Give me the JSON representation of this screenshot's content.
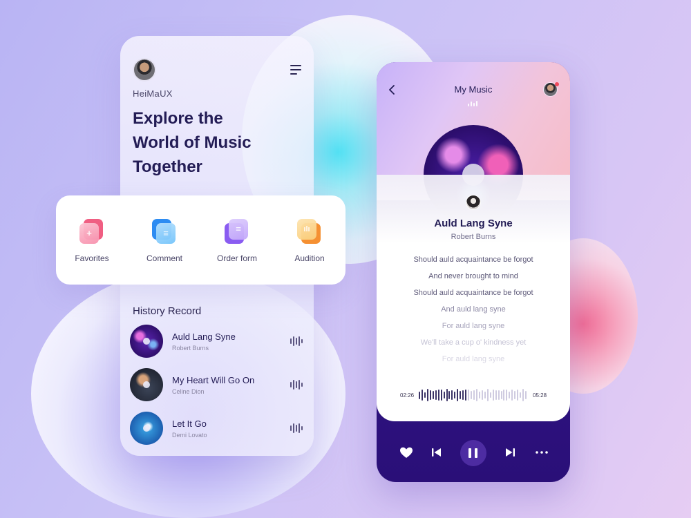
{
  "left_screen": {
    "user_name": "HeiMaUX",
    "hero_title_lines": [
      "Explore the",
      "World of Music",
      "Together"
    ],
    "history_title": "History Record",
    "history": [
      {
        "title": "Auld Lang Syne",
        "artist": "Robert Burns"
      },
      {
        "title": "My Heart Will Go On",
        "artist": "Celine Dion"
      },
      {
        "title": "Let It Go",
        "artist": "Demi Lovato"
      }
    ]
  },
  "categories": [
    {
      "label": "Favorites",
      "icon": "plus-icon",
      "colors": [
        "#f9a7bf",
        "#f05e82"
      ]
    },
    {
      "label": "Comment",
      "icon": "comment-icon",
      "colors": [
        "#74c5fb",
        "#2d8cf2"
      ]
    },
    {
      "label": "Order form",
      "icon": "order-icon",
      "colors": [
        "#c3a8fb",
        "#8a5cf1"
      ]
    },
    {
      "label": "Audition",
      "icon": "audition-icon",
      "colors": [
        "#fbd07d",
        "#f59032"
      ]
    }
  ],
  "player": {
    "title": "My Music",
    "song_title": "Auld Lang Syne",
    "song_artist": "Robert Burns",
    "lyrics": [
      "Should auld acquaintance be forgot",
      "And never brought to mind",
      "Should auld acquaintance be forgot",
      "And auld lang syne",
      "For auld lang syne",
      "We'll take a cup o' kindness yet",
      "For auld lang syne"
    ],
    "time_current": "02:26",
    "time_total": "05:28",
    "progress": 0.45
  },
  "colors": {
    "accent_dark": "#231c55",
    "player_bottom": "#2a0f78",
    "notification": "#f04a5c"
  }
}
